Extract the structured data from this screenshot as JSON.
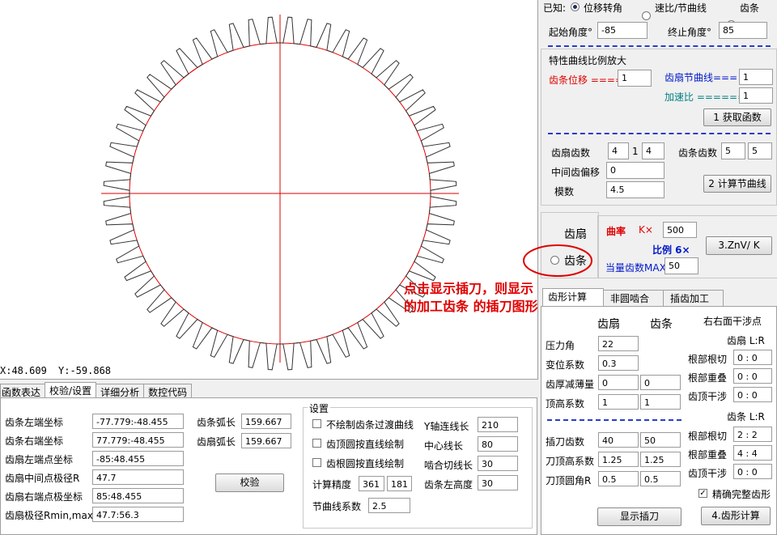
{
  "canvas": {
    "x_readout": "X:48.609",
    "y_readout": "Y:-59.868"
  },
  "note": "点击显示插刀，则显示的加工齿条  的插刀图形",
  "bottom_tabs": [
    "函数表达",
    "校验/设置",
    "详细分析",
    "数控代码"
  ],
  "check": {
    "rows": [
      {
        "label": "齿条左端坐标",
        "value": "-77.779:-48.455"
      },
      {
        "label": "齿条右端坐标",
        "value": "77.779:-48.455"
      },
      {
        "label": "齿扇左端点坐标",
        "value": "-85:48.455"
      },
      {
        "label": "齿扇中间点极径R",
        "value": "47.7"
      },
      {
        "label": "齿扇右端点极坐标",
        "value": "85:48.455"
      },
      {
        "label": "齿扇极径Rmin,max",
        "value": "47.7:56.3"
      }
    ],
    "rack_arc_label": "齿条弧长",
    "rack_arc": "159.667",
    "sector_arc_label": "齿扇弧长",
    "sector_arc": "159.667",
    "verify_button": "校验"
  },
  "settings": {
    "title": "设置",
    "checkboxes": [
      "不绘制齿条过渡曲线",
      "齿顶圆按直线绘制",
      "齿根圆按直线绘制"
    ],
    "precision_label": "计算精度",
    "precision_a": "361",
    "precision_b": "181",
    "pitch_label": "节曲线系数",
    "pitch_value": "2.5",
    "right_rows": [
      {
        "label": "Y轴连线长",
        "value": "210"
      },
      {
        "label": "中心线长",
        "value": "80"
      },
      {
        "label": "啮合切线长",
        "value": "30"
      },
      {
        "label": "齿条左高度",
        "value": "30"
      }
    ]
  },
  "known": {
    "label": "已知:",
    "opt1": "位移转角",
    "opt2": "速比/节曲线",
    "opt3": "齿条",
    "start_label": "起始角度°",
    "start_value": "-85",
    "end_label": "终止角度°",
    "end_value": "85"
  },
  "scale": {
    "title": "特性曲线比例放大",
    "rack_disp_label": "齿条位移 ====",
    "rack_disp": "1",
    "sector_pitch_label": "齿扇节曲线=== =",
    "sector_pitch": "1",
    "accel_label": "加速比 ====== =",
    "accel": "1",
    "get_func_button": "1 获取函数"
  },
  "teeth": {
    "sector_label": "齿扇齿数",
    "sector_a": "4",
    "sector_sep": "1",
    "sector_b": "4",
    "rack_label": "齿条齿数",
    "rack_a": "5",
    "rack_b": "5",
    "offset_label": "中间齿偏移",
    "offset": "0",
    "module_label": "模数",
    "module": "4.5",
    "calc_pitch_button": "2 计算节曲线"
  },
  "display": {
    "opt_sector": "齿扇",
    "opt_rack": "齿条",
    "curvature_label": "曲率",
    "k_label": "K×",
    "k_value": "500",
    "ratio_label": "比例 6×",
    "equiv_label": "当量齿数MAX",
    "equiv_value": "50",
    "znv_button": "3.ZnV/ K"
  },
  "right_tabs": [
    "齿形计算",
    "非圆啮合",
    "插齿加工"
  ],
  "profile": {
    "head_sector": "齿扇",
    "head_rack": "齿条",
    "rows": [
      {
        "label": "压力角",
        "a": "22",
        "b": ""
      },
      {
        "label": "变位系数",
        "a": "0.3",
        "b": ""
      },
      {
        "label": "齿厚减薄量",
        "a": "0",
        "b": "0"
      },
      {
        "label": "顶高系数",
        "a": "1",
        "b": "1"
      }
    ],
    "cutter_rows": [
      {
        "label": "插刀齿数",
        "a": "40",
        "b": "50"
      },
      {
        "label": "刀顶高系数",
        "a": "1.25",
        "b": "1.25"
      },
      {
        "label": "刀顶圆角R",
        "a": "0.5",
        "b": "0.5"
      }
    ],
    "interf_title": "右右面干涉点",
    "sector_lr": "齿扇 L:R",
    "sector_rows": [
      {
        "label": "根部根切",
        "value": "0 : 0"
      },
      {
        "label": "根部重叠",
        "value": "0 : 0"
      },
      {
        "label": "齿顶干涉",
        "value": "0 : 0"
      }
    ],
    "rack_lr": "齿条 L:R",
    "rack_rows": [
      {
        "label": "根部根切",
        "value": "2 : 2"
      },
      {
        "label": "根部重叠",
        "value": "4 : 4"
      },
      {
        "label": "齿顶干涉",
        "value": "0 : 0"
      }
    ],
    "precise_label": "精确完整齿形",
    "show_cutter_button": "显示插刀",
    "calc_button": "4.齿形计算"
  },
  "gear": {
    "teeth": 56
  }
}
